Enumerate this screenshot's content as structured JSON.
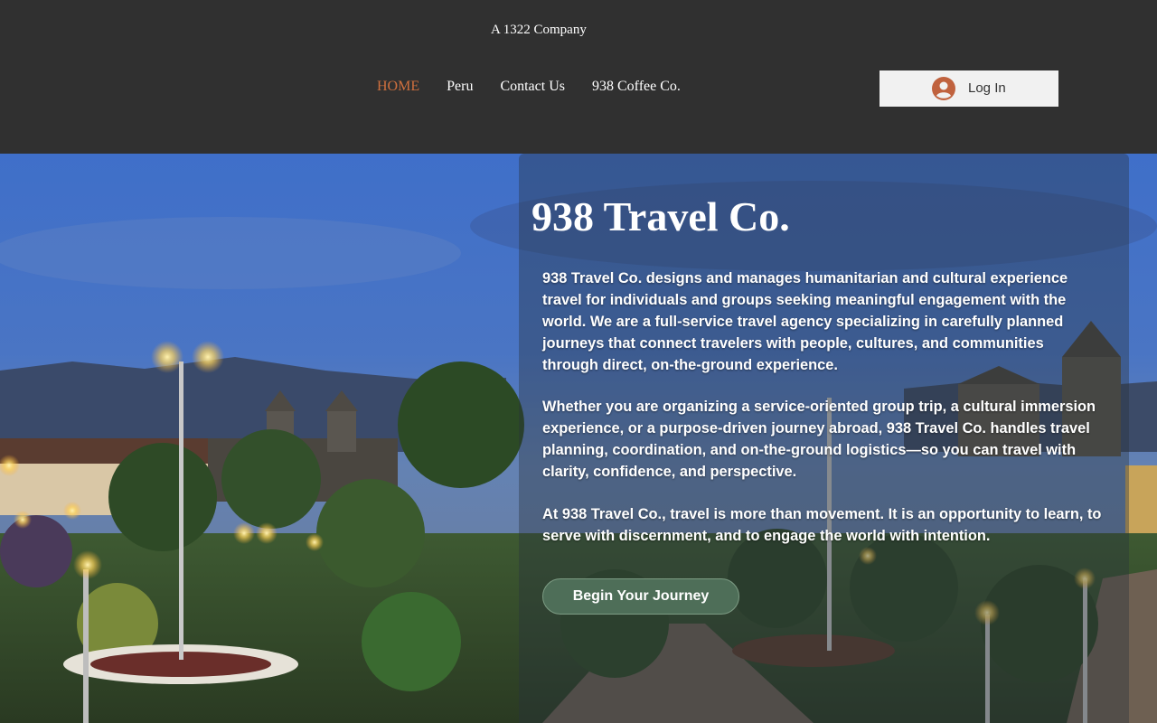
{
  "header": {
    "tagline": "A 1322 Company",
    "nav": [
      {
        "label": "HOME",
        "active": true
      },
      {
        "label": "Peru",
        "active": false
      },
      {
        "label": "Contact Us",
        "active": false
      },
      {
        "label": "938 Coffee Co.",
        "active": false
      }
    ],
    "login": {
      "label": "Log In",
      "icon": "user-avatar-icon"
    }
  },
  "hero": {
    "background": "town square at dusk with palm trees, street lamps and cathedral towers",
    "title": "938 Travel Co.",
    "paragraphs": [
      "938 Travel Co. designs and manages humanitarian and cultural experience travel for individuals and groups seeking meaningful engagement with the world. We are a full-service travel agency specializing in carefully planned journeys that connect travelers with people, cultures, and communities through direct, on-the-ground experience.",
      "Whether you are organizing a service-oriented group trip, a cultural immersion experience, or a purpose-driven journey abroad, 938 Travel Co. handles travel planning, coordination, and on-the-ground logistics—so you can travel with clarity, confidence, and perspective.",
      "At 938 Travel Co., travel is more than movement. It is an opportunity to learn, to serve with discernment, and to engage the world with intention."
    ],
    "cta_label": "Begin Your Journey"
  },
  "colors": {
    "header_bg": "#303030",
    "nav_active": "#d0703e",
    "cta_bg": "#4e6e58",
    "login_bg": "#f1f1f1",
    "avatar": "#c0623e"
  }
}
